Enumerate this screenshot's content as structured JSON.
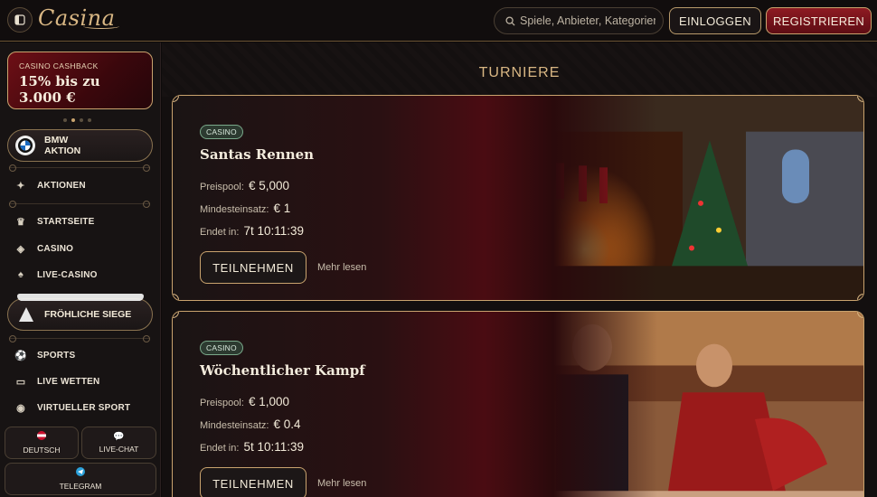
{
  "header": {
    "logo_text": "Casina",
    "search_placeholder": "Spiele, Anbieter, Kategorien",
    "login_label": "EINLOGGEN",
    "register_label": "REGISTRIEREN"
  },
  "sidebar": {
    "promo": {
      "kicker": "CASINO CASHBACK",
      "headline": "15% bis zu 3.000 €"
    },
    "carousel_dots": 4,
    "bmw": {
      "line1": "BMW",
      "line2": "AKTION"
    },
    "nav": [
      {
        "label": "AKTIONEN",
        "icon": "gift-icon"
      },
      {
        "label": "STARTSEITE",
        "icon": "crown-icon"
      },
      {
        "label": "CASINO",
        "icon": "slot-icon"
      },
      {
        "label": "LIVE-CASINO",
        "icon": "cards-icon"
      }
    ],
    "xmas_label": "FRÖHLICHE SIEGE",
    "nav2": [
      {
        "label": "SPORTS",
        "icon": "soccer-ball-icon"
      },
      {
        "label": "LIVE WETTEN",
        "icon": "live-icon"
      },
      {
        "label": "VIRTUELLER SPORT",
        "icon": "virtual-icon"
      }
    ],
    "tiles": {
      "lang": "DEUTSCH",
      "chat": "LIVE-CHAT",
      "telegram": "TELEGRAM"
    }
  },
  "main": {
    "section_title": "TURNIERE",
    "tournaments": [
      {
        "badge": "CASINO",
        "title": "Santas Rennen",
        "prize_label": "Preispool:",
        "prize_value": "€ 5,000",
        "min_label": "Mindesteinsatz:",
        "min_value": "€ 1",
        "ends_label": "Endet in:",
        "ends_value": "7t 10:11:39",
        "join_label": "TEILNEHMEN",
        "more_label": "Mehr lesen"
      },
      {
        "badge": "CASINO",
        "title": "Wöchentlicher Kampf",
        "prize_label": "Preispool:",
        "prize_value": "€ 1,000",
        "min_label": "Mindesteinsatz:",
        "min_value": "€ 0.4",
        "ends_label": "Endet in:",
        "ends_value": "5t 10:11:39",
        "join_label": "TEILNEHMEN",
        "more_label": "Mehr lesen"
      }
    ]
  },
  "colors": {
    "gold": "#c9a36e",
    "crimson": "#8e1a22",
    "badge_green": "#7aa98a"
  }
}
